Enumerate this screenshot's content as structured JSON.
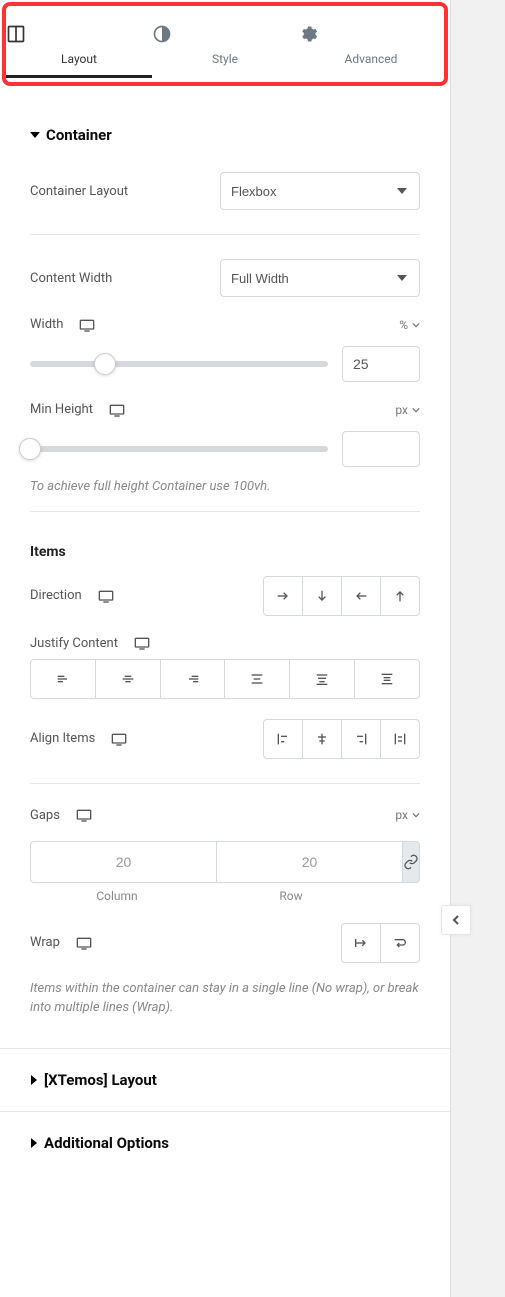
{
  "tabs": {
    "layout": "Layout",
    "style": "Style",
    "advanced": "Advanced"
  },
  "section": {
    "container": "Container",
    "container_layout_label": "Container Layout",
    "container_layout_value": "Flexbox",
    "content_width_label": "Content Width",
    "content_width_value": "Full Width",
    "width_label": "Width",
    "width_unit": "%",
    "width_value": "25",
    "min_height_label": "Min Height",
    "min_height_unit": "px",
    "min_height_value": "",
    "height_hint": "To achieve full height Container use 100vh.",
    "items_label": "Items",
    "direction_label": "Direction",
    "justify_label": "Justify Content",
    "align_label": "Align Items",
    "gaps_label": "Gaps",
    "gaps_unit": "px",
    "gap_column_value": "20",
    "gap_row_value": "20",
    "gap_column_label": "Column",
    "gap_row_label": "Row",
    "wrap_label": "Wrap",
    "wrap_hint": "Items within the container can stay in a single line (No wrap), or break into multiple lines (Wrap)."
  },
  "collapsed": {
    "xtemos": "[XTemos] Layout",
    "additional": "Additional Options"
  }
}
